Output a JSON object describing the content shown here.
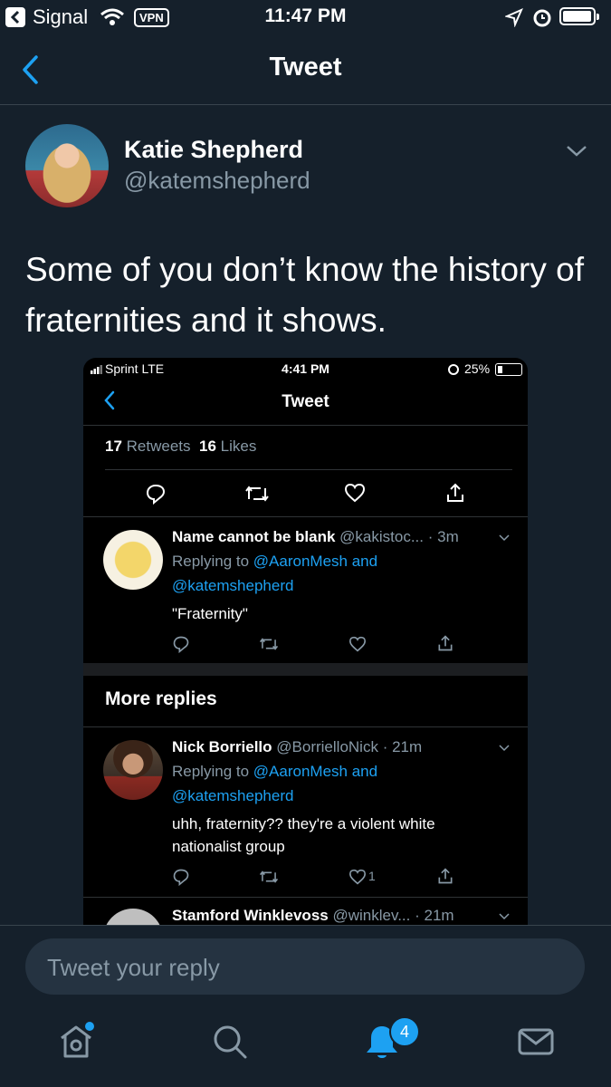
{
  "status_bar": {
    "back_app": "Signal",
    "vpn": "VPN",
    "time": "11:47 PM"
  },
  "nav": {
    "title": "Tweet"
  },
  "tweet": {
    "author_name": "Katie Shepherd",
    "author_handle": "@katemshepherd",
    "text": "Some of you don’t know the history of fraternities and it shows."
  },
  "embedded": {
    "status": {
      "carrier": "Sprint  LTE",
      "time": "4:41 PM",
      "battery": "25%"
    },
    "title": "Tweet",
    "stats": {
      "retweets_count": "17",
      "retweets_label": "Retweets",
      "likes_count": "16",
      "likes_label": "Likes"
    },
    "replies": [
      {
        "name": "Name cannot be blank",
        "handle": "@kakistoc...",
        "time": "· 3m",
        "replying_prefix": "Replying to",
        "replying_line1": "@AaronMesh and",
        "replying_line2": "@katemshepherd",
        "text": "\"Fraternity\""
      }
    ],
    "more_replies_label": "More replies",
    "more": [
      {
        "name": "Nick Borriello",
        "handle": "@BorrielloNick",
        "time": "· 21m",
        "replying_prefix": "Replying to",
        "replying_line1": "@AaronMesh and",
        "replying_line2": "@katemshepherd",
        "text_line1": "uhh, fraternity?? they're a violent white",
        "text_line2": "nationalist group",
        "like_count": "1"
      },
      {
        "name": "Stamford Winklevoss",
        "handle": "@winklev...",
        "time": "· 21m"
      }
    ]
  },
  "reply": {
    "placeholder": "Tweet your reply"
  },
  "tab_bar": {
    "notifications_badge": "4"
  },
  "colors": {
    "background": "#15202b",
    "accent": "#1da1f2",
    "muted": "#8899a6"
  }
}
